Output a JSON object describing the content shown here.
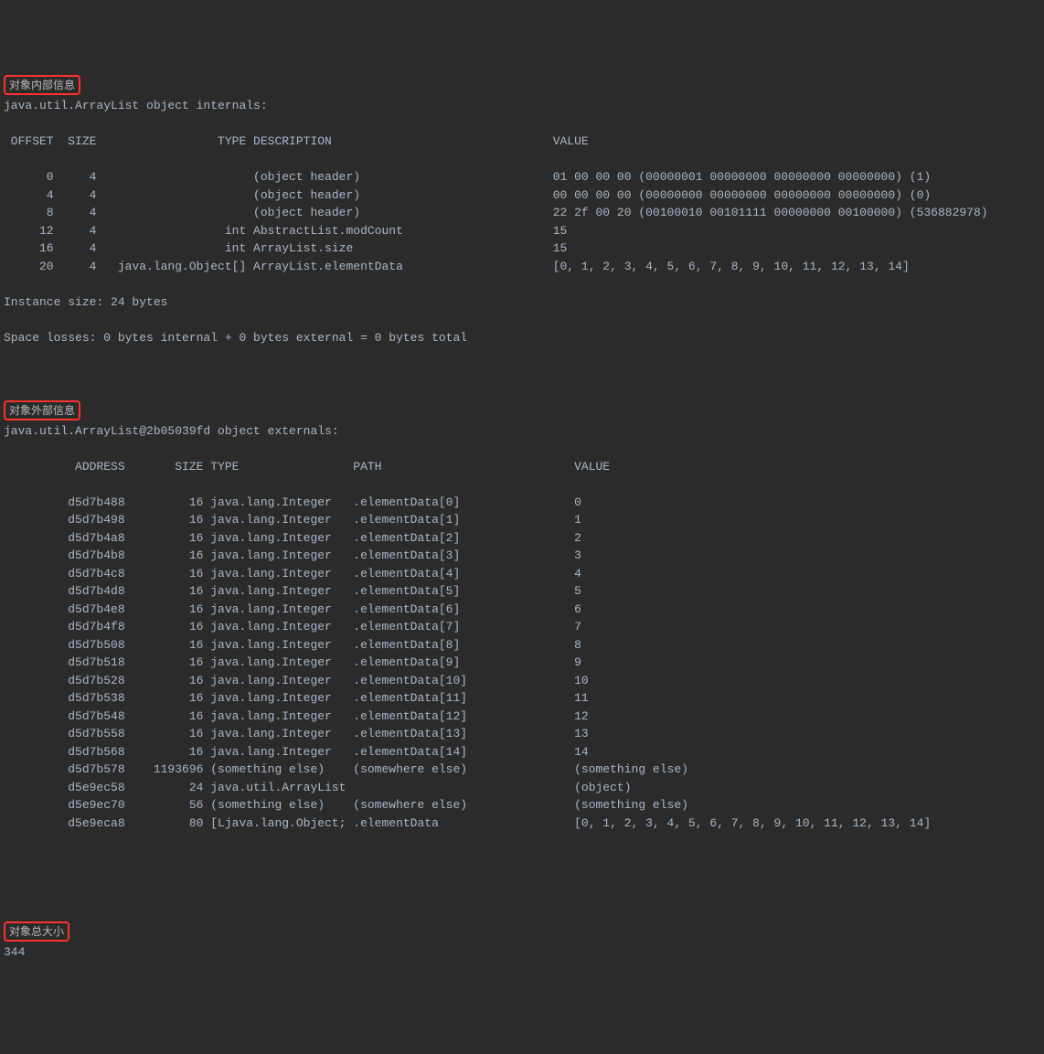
{
  "section1": {
    "label": "对象内部信息",
    "header": "java.util.ArrayList object internals:",
    "columns": " OFFSET  SIZE                 TYPE DESCRIPTION                               VALUE",
    "rows": [
      "      0     4                      (object header)                           01 00 00 00 (00000001 00000000 00000000 00000000) (1)",
      "      4     4                      (object header)                           00 00 00 00 (00000000 00000000 00000000 00000000) (0)",
      "      8     4                      (object header)                           22 2f 00 20 (00100010 00101111 00000000 00100000) (536882978)",
      "     12     4                  int AbstractList.modCount                     15",
      "     16     4                  int ArrayList.size                            15",
      "     20     4   java.lang.Object[] ArrayList.elementData                     [0, 1, 2, 3, 4, 5, 6, 7, 8, 9, 10, 11, 12, 13, 14]"
    ],
    "footer1": "Instance size: 24 bytes",
    "footer2": "Space losses: 0 bytes internal + 0 bytes external = 0 bytes total"
  },
  "section2": {
    "label": "对象外部信息",
    "header": "java.util.ArrayList@2b05039fd object externals:",
    "columns": "          ADDRESS       SIZE TYPE                PATH                           VALUE",
    "rows": [
      "         d5d7b488         16 java.lang.Integer   .elementData[0]                0",
      "         d5d7b498         16 java.lang.Integer   .elementData[1]                1",
      "         d5d7b4a8         16 java.lang.Integer   .elementData[2]                2",
      "         d5d7b4b8         16 java.lang.Integer   .elementData[3]                3",
      "         d5d7b4c8         16 java.lang.Integer   .elementData[4]                4",
      "         d5d7b4d8         16 java.lang.Integer   .elementData[5]                5",
      "         d5d7b4e8         16 java.lang.Integer   .elementData[6]                6",
      "         d5d7b4f8         16 java.lang.Integer   .elementData[7]                7",
      "         d5d7b508         16 java.lang.Integer   .elementData[8]                8",
      "         d5d7b518         16 java.lang.Integer   .elementData[9]                9",
      "         d5d7b528         16 java.lang.Integer   .elementData[10]               10",
      "         d5d7b538         16 java.lang.Integer   .elementData[11]               11",
      "         d5d7b548         16 java.lang.Integer   .elementData[12]               12",
      "         d5d7b558         16 java.lang.Integer   .elementData[13]               13",
      "         d5d7b568         16 java.lang.Integer   .elementData[14]               14",
      "         d5d7b578    1193696 (something else)    (somewhere else)               (something else)",
      "         d5e9ec58         24 java.util.ArrayList                                (object)",
      "         d5e9ec70         56 (something else)    (somewhere else)               (something else)",
      "         d5e9eca8         80 [Ljava.lang.Object; .elementData                   [0, 1, 2, 3, 4, 5, 6, 7, 8, 9, 10, 11, 12, 13, 14]"
    ]
  },
  "section3": {
    "label": "对象总大小",
    "value": "344"
  }
}
